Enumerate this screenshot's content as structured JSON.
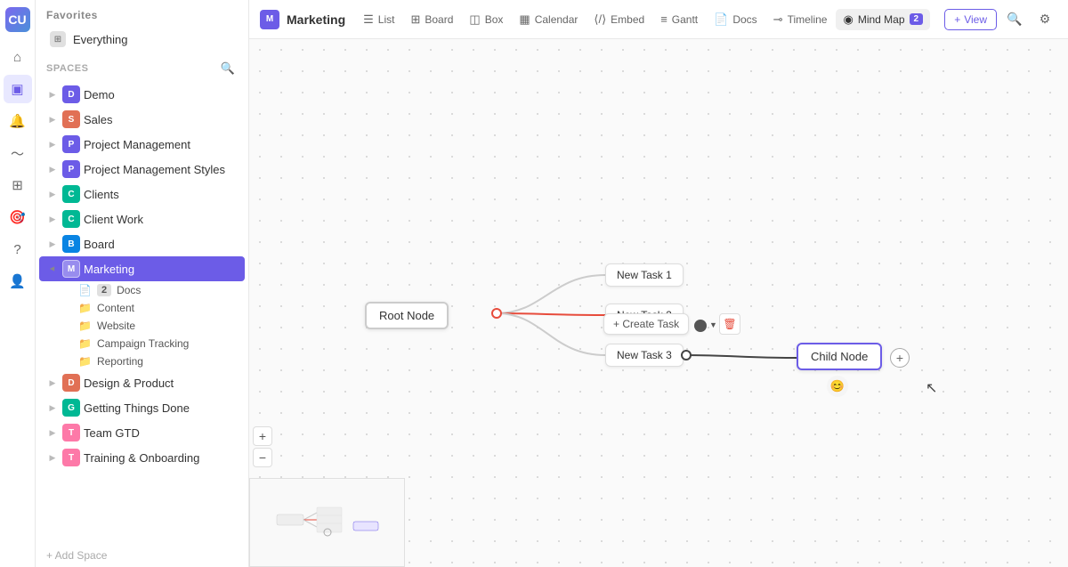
{
  "app": {
    "logo": "CU"
  },
  "sidebar": {
    "favorites_label": "Favorites",
    "spaces_label": "Spaces",
    "everything_label": "Everything",
    "spaces": [
      {
        "id": "demo",
        "label": "Demo",
        "badge": "D",
        "color": "#6c5ce7",
        "collapsed": true
      },
      {
        "id": "sales",
        "label": "Sales",
        "badge": "S",
        "color": "#e17055",
        "collapsed": true
      },
      {
        "id": "project-management",
        "label": "Project Management",
        "badge": "P",
        "color": "#6c5ce7",
        "collapsed": true
      },
      {
        "id": "project-management-styles",
        "label": "Project Management Styles",
        "badge": "P",
        "color": "#6c5ce7",
        "collapsed": true
      },
      {
        "id": "clients",
        "label": "Clients",
        "badge": "C",
        "color": "#00b894",
        "collapsed": true
      },
      {
        "id": "client-work",
        "label": "Client Work",
        "badge": "C",
        "color": "#00b894",
        "collapsed": true
      },
      {
        "id": "board",
        "label": "Board",
        "badge": "B",
        "color": "#0984e3",
        "collapsed": true
      },
      {
        "id": "marketing",
        "label": "Marketing",
        "badge": "M",
        "color": "#6c5ce7",
        "active": true,
        "open": true
      },
      {
        "id": "design-product",
        "label": "Design & Product",
        "badge": "D",
        "color": "#e17055",
        "collapsed": true
      },
      {
        "id": "getting-things-done",
        "label": "Getting Things Done",
        "badge": "G",
        "color": "#00b894",
        "collapsed": true
      },
      {
        "id": "team-gtd",
        "label": "Team GTD",
        "badge": "T",
        "color": "#fd79a8",
        "collapsed": true
      },
      {
        "id": "training-onboarding",
        "label": "Training & Onboarding",
        "badge": "T",
        "color": "#fd79a8",
        "collapsed": true
      }
    ],
    "marketing_sub": [
      {
        "id": "docs",
        "label": "Docs",
        "count": "2"
      },
      {
        "id": "content",
        "label": "Content"
      },
      {
        "id": "website",
        "label": "Website"
      },
      {
        "id": "campaign-tracking",
        "label": "Campaign Tracking"
      },
      {
        "id": "reporting",
        "label": "Reporting"
      }
    ],
    "add_space_label": "+ Add Space"
  },
  "topbar": {
    "breadcrumb_icon": "M",
    "title": "Marketing",
    "tabs": [
      {
        "id": "list",
        "label": "List",
        "icon": "☰"
      },
      {
        "id": "board",
        "label": "Board",
        "icon": "⊞"
      },
      {
        "id": "box",
        "label": "Box",
        "icon": "◫"
      },
      {
        "id": "calendar",
        "label": "Calendar",
        "icon": "▦"
      },
      {
        "id": "embed",
        "label": "Embed",
        "icon": "⟨⟩"
      },
      {
        "id": "gantt",
        "label": "Gantt",
        "icon": "≡"
      },
      {
        "id": "docs",
        "label": "Docs",
        "icon": "📄"
      },
      {
        "id": "timeline",
        "label": "Timeline",
        "icon": "⊸"
      },
      {
        "id": "mind-map",
        "label": "Mind Map",
        "icon": "◉",
        "badge": "2",
        "active": true
      }
    ],
    "view_label": "View",
    "plus_label": "+"
  },
  "mind_map": {
    "root_node": "Root Node",
    "task1": "New Task 1",
    "task2": "New Task 2",
    "task3": "New Task 3",
    "child_node": "Child Node",
    "create_task_label": "+ Create Task"
  }
}
